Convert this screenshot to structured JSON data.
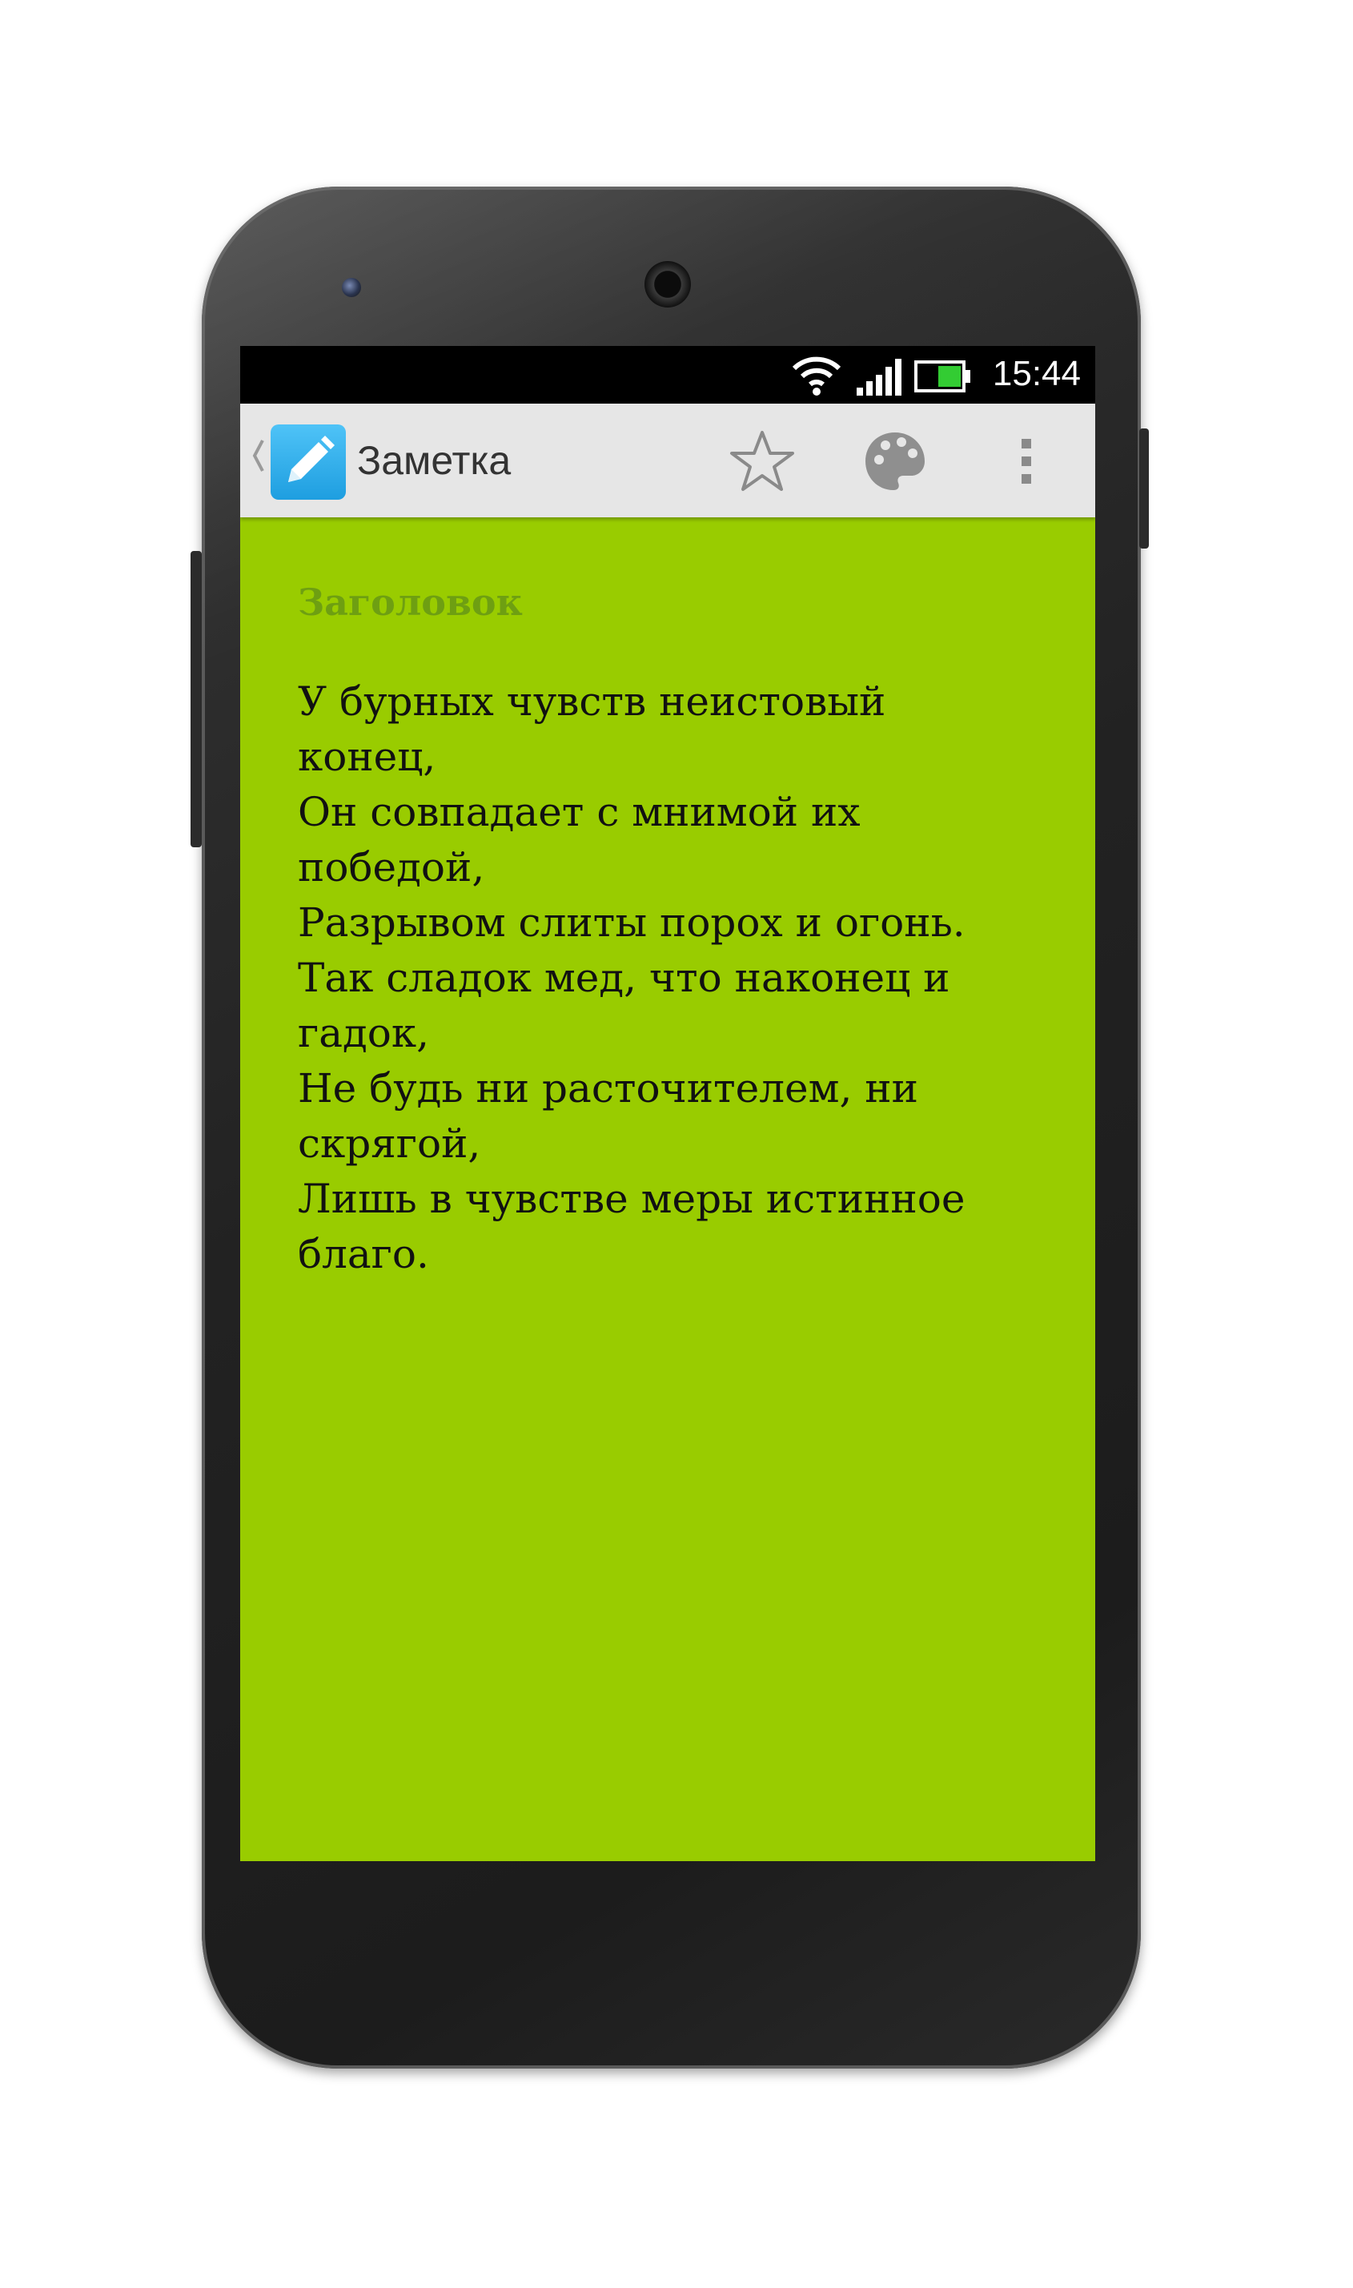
{
  "status_bar": {
    "time": "15:44",
    "icons": [
      "wifi-icon",
      "signal-icon",
      "battery-icon"
    ],
    "battery_color": "#33cc33"
  },
  "action_bar": {
    "title": "Заметка",
    "icons": [
      "back-caret-icon",
      "pencil-icon",
      "star-icon",
      "palette-icon",
      "overflow-menu-icon"
    ],
    "app_icon_color": "#29a9e9"
  },
  "note": {
    "title_placeholder": "Заголовок",
    "body": "У бурных чувств неистовый\nконец,\nОн совпадает с мнимой их\nпобедой,\nРазрывом слиты порох и огонь.\nТак сладок мед, что наконец и\nгадок,\nНе будь ни расточителем, ни\nскрягой,\nЛишь в чувстве меры истинное\nблаго.",
    "background_color": "#99cc00"
  }
}
